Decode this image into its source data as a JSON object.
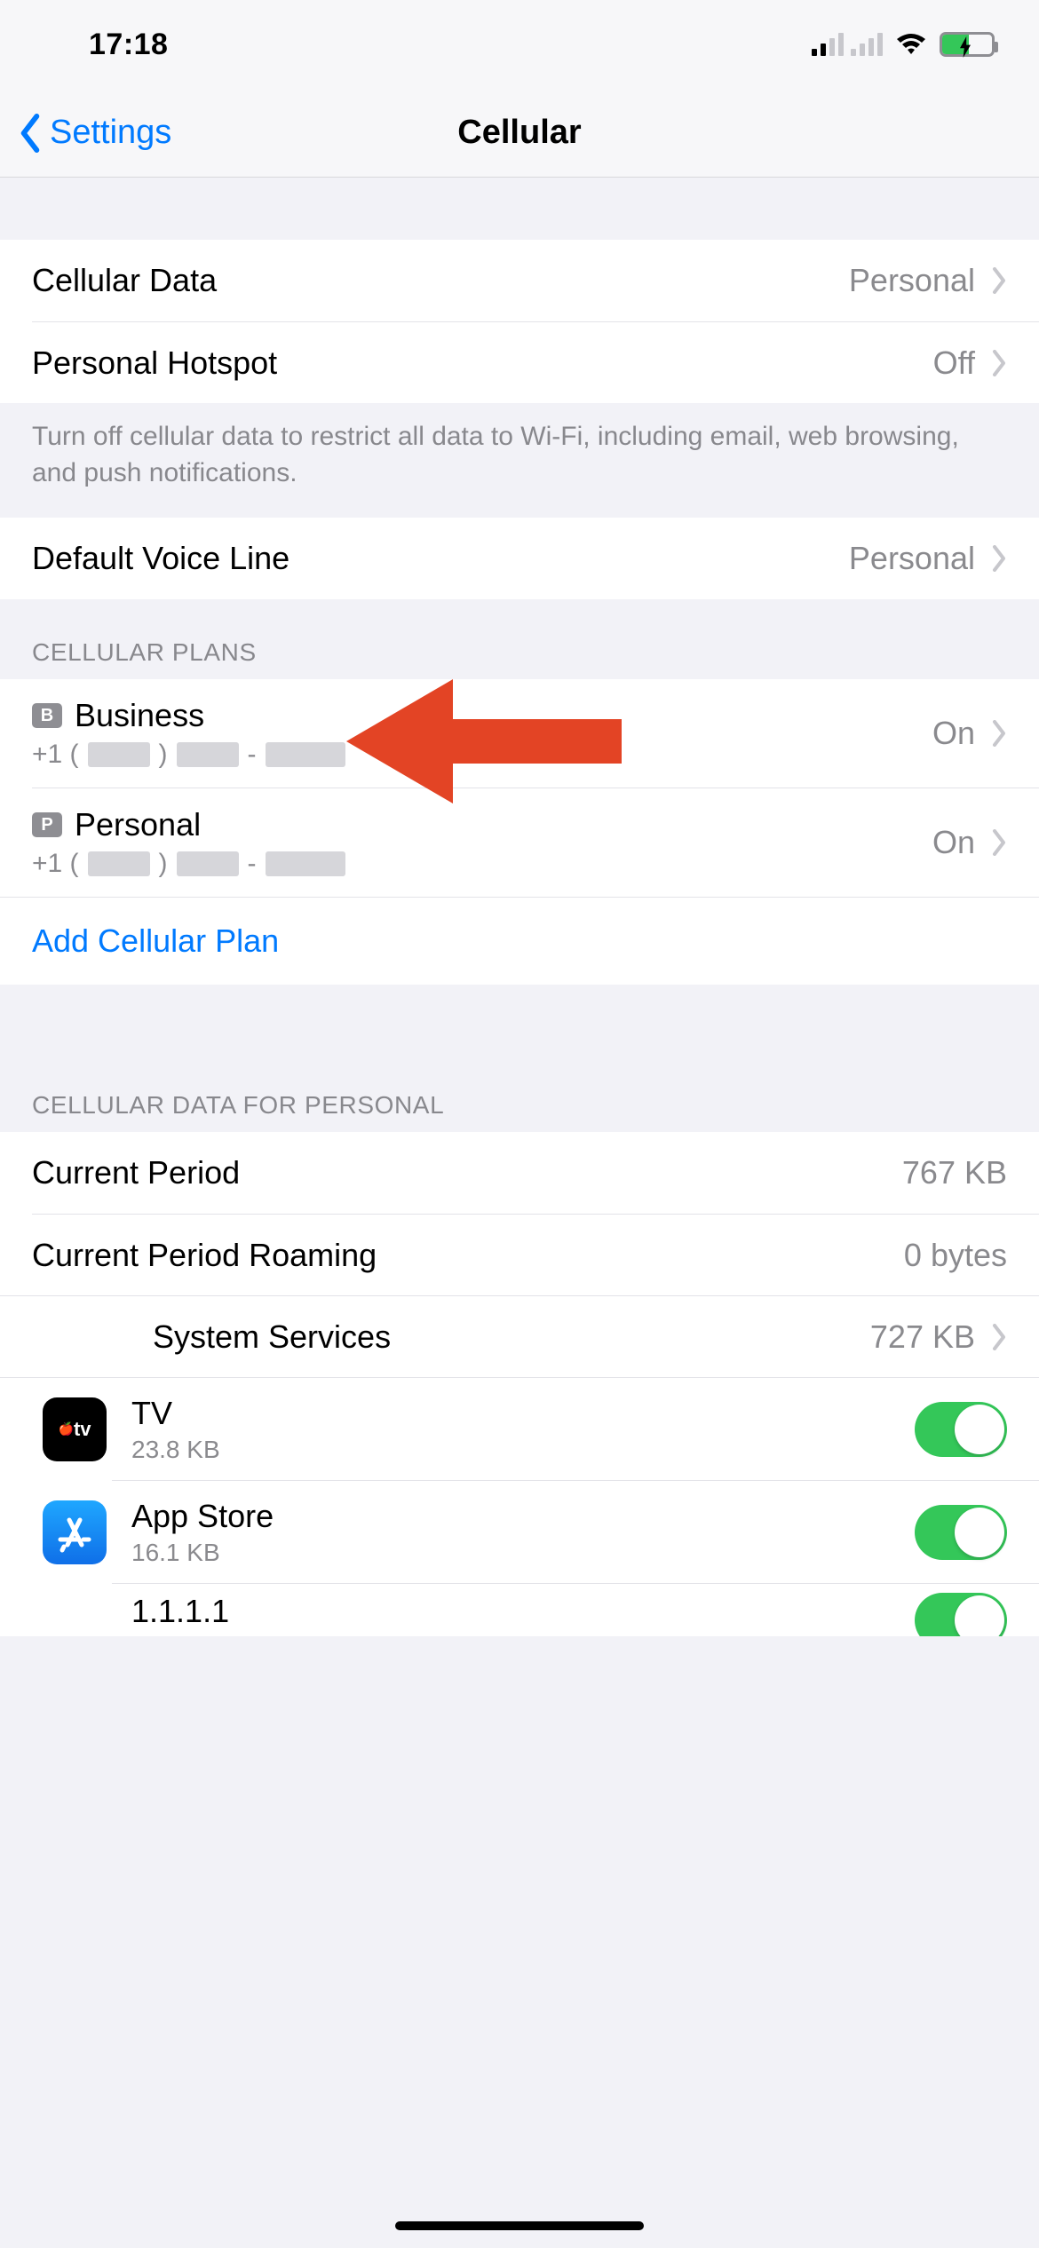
{
  "statusbar": {
    "time": "17:18"
  },
  "nav": {
    "back": "Settings",
    "title": "Cellular"
  },
  "group1": {
    "cellular_data_label": "Cellular Data",
    "cellular_data_value": "Personal",
    "hotspot_label": "Personal Hotspot",
    "hotspot_value": "Off",
    "footer": "Turn off cellular data to restrict all data to Wi-Fi, including email, web browsing, and push notifications."
  },
  "group2": {
    "voice_line_label": "Default Voice Line",
    "voice_line_value": "Personal"
  },
  "plans_header": "CELLULAR PLANS",
  "plans": [
    {
      "badge": "B",
      "name": "Business",
      "phone_prefix": "+1 (",
      "phone_sep": ")",
      "phone_dash": "-",
      "status": "On"
    },
    {
      "badge": "P",
      "name": "Personal",
      "phone_prefix": "+1 (",
      "phone_sep": ")",
      "phone_dash": "-",
      "status": "On"
    }
  ],
  "add_plan": "Add Cellular Plan",
  "usage_header": "CELLULAR DATA FOR PERSONAL",
  "usage": {
    "current_period_label": "Current Period",
    "current_period_value": "767 KB",
    "roaming_label": "Current Period Roaming",
    "roaming_value": "0 bytes",
    "system_services_label": "System Services",
    "system_services_value": "727 KB"
  },
  "apps": [
    {
      "name": "TV",
      "size": "23.8 KB",
      "icon": "tv",
      "toggle": true
    },
    {
      "name": "App Store",
      "size": "16.1 KB",
      "icon": "appstore",
      "toggle": true
    },
    {
      "name": "1.1.1.1",
      "size": "",
      "icon": "1111",
      "toggle": true
    }
  ],
  "annotation": {
    "kind": "arrow",
    "color": "#e34425"
  }
}
